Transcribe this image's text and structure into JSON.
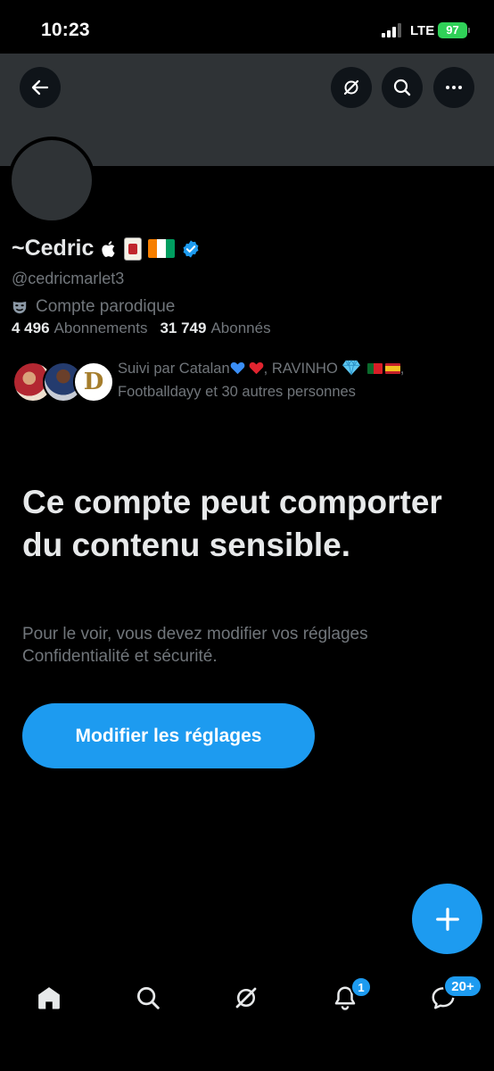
{
  "status_bar": {
    "time": "10:23",
    "network": "LTE",
    "battery": "97"
  },
  "header": {
    "back_icon": "arrow-left-icon",
    "grok_icon": "grok-icon",
    "search_icon": "search-icon",
    "more_icon": "more-horizontal-icon"
  },
  "profile": {
    "display_name": "~Cedric",
    "name_emojis": [
      "apple",
      "mahjong-red-dragon",
      "flag-cote-divoire"
    ],
    "verified": true,
    "handle": "@cedricmarlet3",
    "parody_label": "Compte parodique",
    "following_count": "4 496",
    "following_label": "Abonnements",
    "followers_count": "31 749",
    "followers_label": "Abonnés"
  },
  "followed_by": {
    "line1_prefix": "Suivi par Catalan",
    "line1_middle": ", RAVINHO",
    "line1_suffix": ",",
    "line2": "Footballdayy et 30 autres personnes",
    "avatar3_letter": "D"
  },
  "sensitive": {
    "title": "Ce compte peut comporter du contenu sensible.",
    "description": "Pour le voir, vous devez modifier vos réglages Confidentialité et sécurité.",
    "button_label": "Modifier les réglages"
  },
  "fab": {
    "icon": "plus-icon"
  },
  "bottom_nav": {
    "items": [
      "home",
      "search",
      "grok",
      "notifications",
      "messages"
    ],
    "notifications_badge": "1",
    "messages_badge": "20+"
  },
  "colors": {
    "accent": "#1d9bf0",
    "background": "#000000",
    "banner": "#2f3336",
    "secondary_text": "#71767b",
    "primary_text": "#e7e9ea"
  }
}
